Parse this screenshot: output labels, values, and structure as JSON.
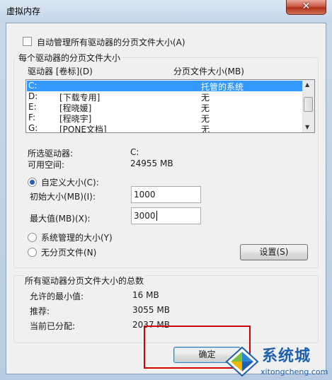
{
  "window": {
    "title": "虚拟内存",
    "close_glyph": "✕"
  },
  "auto_manage": {
    "label": "自动管理所有驱动器的分页文件大小(A)",
    "checked": false
  },
  "per_drive": {
    "group_title": "每个驱动器的分页文件大小",
    "col_drive": "驱动器 [卷标](D)",
    "col_size": "分页文件大小(MB)",
    "rows": [
      {
        "drive": "C:",
        "label": "",
        "size": "托管的系统",
        "selected": true
      },
      {
        "drive": "D:",
        "label": "[下载专用]",
        "size": "无",
        "selected": false
      },
      {
        "drive": "E:",
        "label": "[程晓媛]",
        "size": "无",
        "selected": false
      },
      {
        "drive": "F:",
        "label": "[程晓宇]",
        "size": "无",
        "selected": false
      },
      {
        "drive": "G:",
        "label": "[PONE文档]",
        "size": "无",
        "selected": false
      }
    ],
    "selected_drive_label": "所选驱动器:",
    "selected_drive_value": "C:",
    "free_space_label": "可用空间:",
    "free_space_value": "24955 MB",
    "custom_size_label": "自定义大小(C):",
    "custom_selected": true,
    "initial_label": "初始大小(MB)(I):",
    "initial_value": "1000",
    "max_label": "最大值(MB)(X):",
    "max_value": "3000",
    "system_managed_label": "系统管理的大小(Y)",
    "no_paging_label": "无分页文件(N)",
    "set_button": "设置(S)"
  },
  "totals": {
    "group_title": "所有驱动器分页文件大小的总数",
    "min_label": "允许的最小值:",
    "min_value": "16 MB",
    "recommended_label": "推荐:",
    "recommended_value": "3055 MB",
    "current_label": "当前已分配:",
    "current_value": "2037 MB"
  },
  "buttons": {
    "ok": "确定"
  },
  "watermark": {
    "text": "系统城",
    "url": "xitongcheng.com"
  },
  "colors": {
    "selection": "#3399ff",
    "highlight_box": "#d40000",
    "watermark": "#1f5fb0"
  }
}
